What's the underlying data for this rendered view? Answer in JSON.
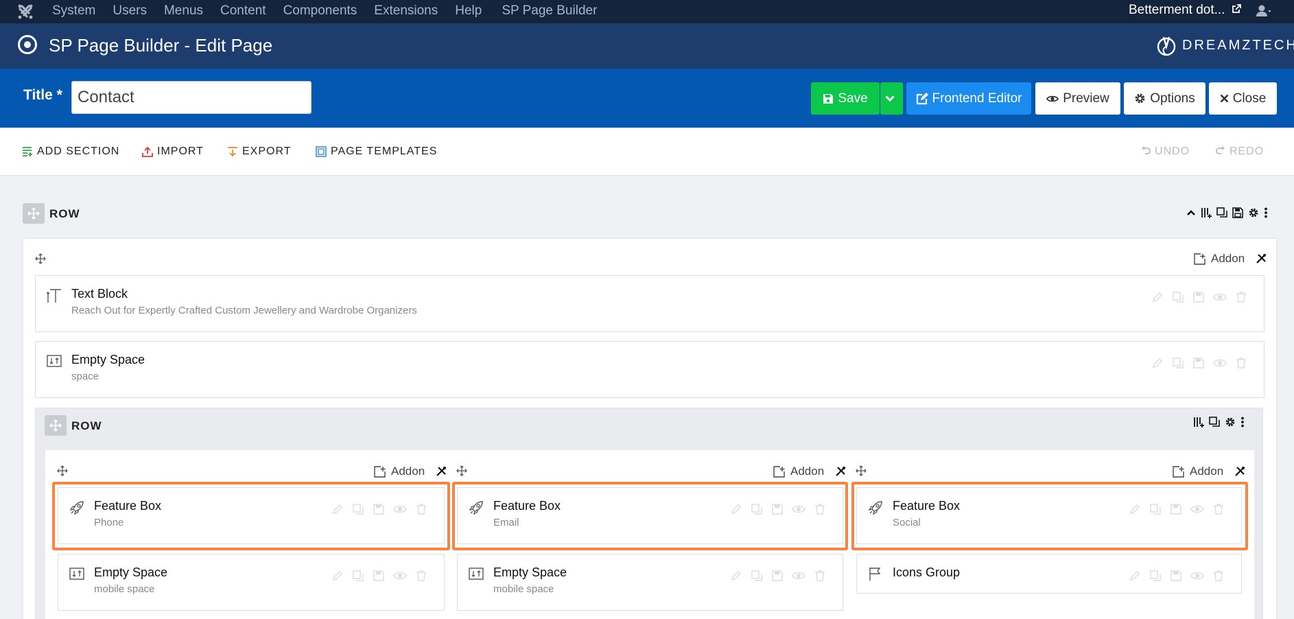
{
  "adminbar": {
    "menu": [
      "System",
      "Users",
      "Menus",
      "Content",
      "Components",
      "Extensions",
      "Help"
    ],
    "extra": "SP Page Builder",
    "site_name": "Betterment dot..."
  },
  "header": {
    "title": "SP Page Builder - Edit Page",
    "brand": "DREAMZTECH"
  },
  "titlebar": {
    "label": "Title *",
    "value": "Contact",
    "buttons": {
      "save": "Save",
      "frontend": "Frontend Editor",
      "preview": "Preview",
      "options": "Options",
      "close": "Close"
    }
  },
  "toolbar": {
    "add_section": "ADD SECTION",
    "import": "IMPORT",
    "export": "EXPORT",
    "templates": "PAGE TEMPLATES",
    "undo": "UNDO",
    "redo": "REDO"
  },
  "outer_row": {
    "label": "ROW",
    "addon_label": "Addon",
    "addons": [
      {
        "name": "Text Block",
        "sub": "Reach Out for Expertly Crafted Custom Jewellery and Wardrobe Organizers",
        "icon": "text-block-icon"
      },
      {
        "name": "Empty Space",
        "sub": "space",
        "icon": "empty-space-icon"
      }
    ]
  },
  "inner_row": {
    "label": "ROW",
    "columns": [
      {
        "addon_label": "Addon",
        "addons": [
          {
            "name": "Feature Box",
            "sub": "Phone",
            "icon": "rocket-icon",
            "highlighted": true
          },
          {
            "name": "Empty Space",
            "sub": "mobile space",
            "icon": "empty-space-icon"
          }
        ]
      },
      {
        "addon_label": "Addon",
        "addons": [
          {
            "name": "Feature Box",
            "sub": "Email",
            "icon": "rocket-icon",
            "highlighted": true
          },
          {
            "name": "Empty Space",
            "sub": "mobile space",
            "icon": "empty-space-icon"
          }
        ]
      },
      {
        "addon_label": "Addon",
        "addons": [
          {
            "name": "Feature Box",
            "sub": "Social",
            "icon": "rocket-icon",
            "highlighted": true
          },
          {
            "name": "Icons Group",
            "sub": "",
            "icon": "flag-icon"
          }
        ]
      }
    ]
  },
  "colors": {
    "adminbar": "#14243d",
    "header": "#1c3d6e",
    "titlebar": "#0458b0",
    "save": "#0bc84a",
    "frontend": "#1a8cf0",
    "highlight": "#f58542"
  }
}
